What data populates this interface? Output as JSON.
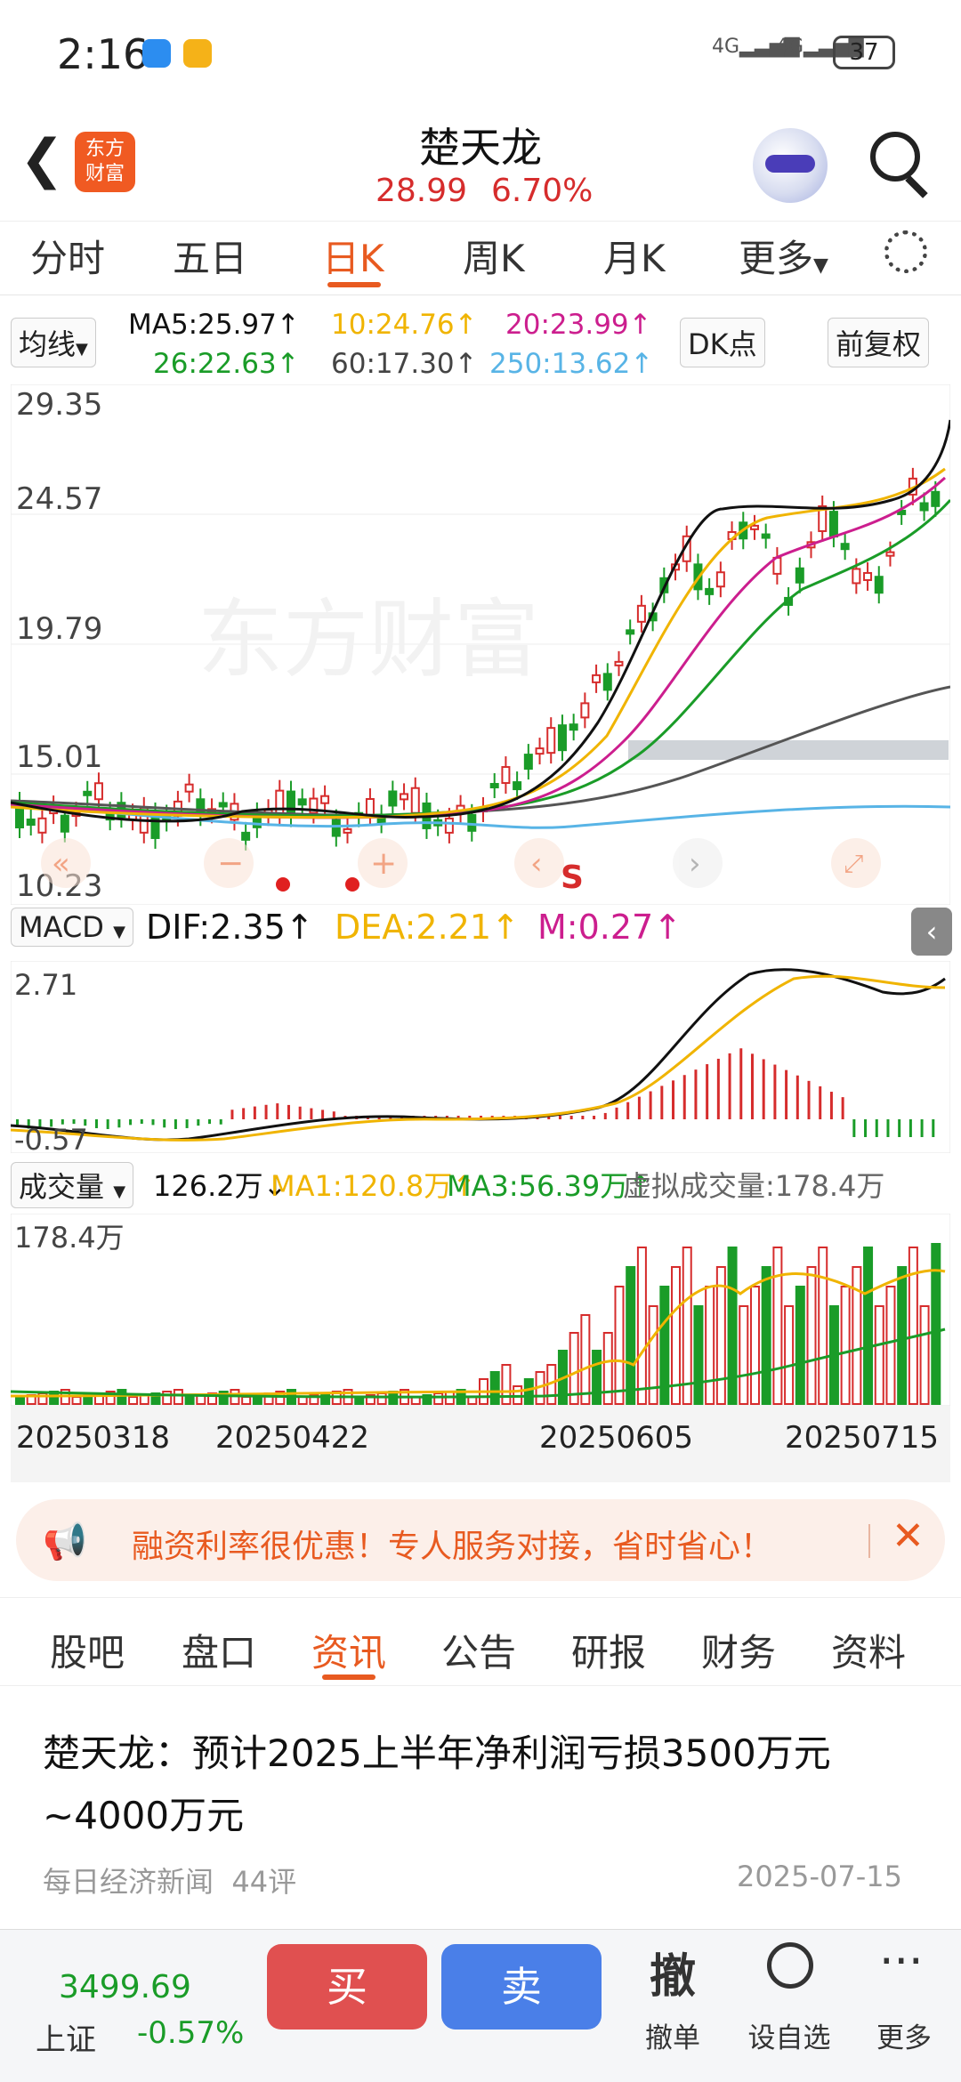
{
  "status": {
    "time": "2:16",
    "signal1": "4G",
    "signal2": "4G",
    "battery": "37"
  },
  "header": {
    "logo_text": [
      "东方",
      "财富"
    ],
    "title": "楚天龙",
    "price": "28.99",
    "change_pct": "6.70%"
  },
  "tabs": [
    "分时",
    "五日",
    "日K",
    "周K",
    "月K",
    "更多"
  ],
  "tabs_active": "日K",
  "indicators": {
    "selector": "均线",
    "ma5": "MA5:25.97↑",
    "ma10": "10:24.76↑",
    "ma20": "20:23.99↑",
    "ma26": "26:22.63↑",
    "ma60": "60:17.30↑",
    "ma250": "250:13.62↑",
    "dk_button": "DK点",
    "fq_button": "前复权"
  },
  "kline": {
    "y_labels": [
      "29.35",
      "24.57",
      "19.79",
      "15.01",
      "10.23"
    ],
    "watermark": "东方财富",
    "s_mark": "S"
  },
  "macd": {
    "selector": "MACD",
    "dif": "DIF:2.35↑",
    "dea": "DEA:2.21↑",
    "m": "M:0.27↑",
    "y_top": "2.71",
    "y_bottom": "-0.57"
  },
  "volume": {
    "selector": "成交量",
    "value": "126.2万↓",
    "ma1": "MA1:120.8万↑",
    "ma3": "MA3:56.39万↑",
    "virtual": "虚拟成交量:178.4万",
    "y_top": "178.4万"
  },
  "dates": [
    "20250318",
    "20250422",
    "20250605",
    "20250715"
  ],
  "promo": {
    "text": "融资利率很优惠！专人服务对接，省时省心！"
  },
  "news_tabs": [
    "股吧",
    "盘口",
    "资讯",
    "公告",
    "研报",
    "财务",
    "资料"
  ],
  "news_tabs_active": "资讯",
  "article": {
    "title": "楚天龙：预计2025上半年净利润亏损3500万元~4000万元",
    "source": "每日经济新闻",
    "comments": "44评",
    "date": "2025-07-15"
  },
  "bottom": {
    "index_value": "3499.69",
    "index_name": "上证",
    "index_change": "-0.57%",
    "buy": "买",
    "sell": "卖",
    "cancel_big": "撤",
    "cancel": "撤单",
    "watch": "设自选",
    "more": "更多"
  },
  "chart_data": {
    "type": "candlestick",
    "ylim": [
      10.23,
      29.35
    ],
    "x_labels": [
      "20250318",
      "20250422",
      "20250605",
      "20250715"
    ],
    "last_close": 28.99,
    "macd": {
      "dif": 2.35,
      "dea": 2.21,
      "m": 0.27
    },
    "volume_unit": "万"
  },
  "colors": {
    "up": "#d62c2c",
    "down": "#1a9c28",
    "accent": "#e85a20",
    "ma5": "#111111",
    "ma10": "#f0b400",
    "ma20": "#cc1e8e",
    "ma26": "#1a9c28",
    "ma60": "#555555",
    "ma250": "#58b4e6"
  }
}
